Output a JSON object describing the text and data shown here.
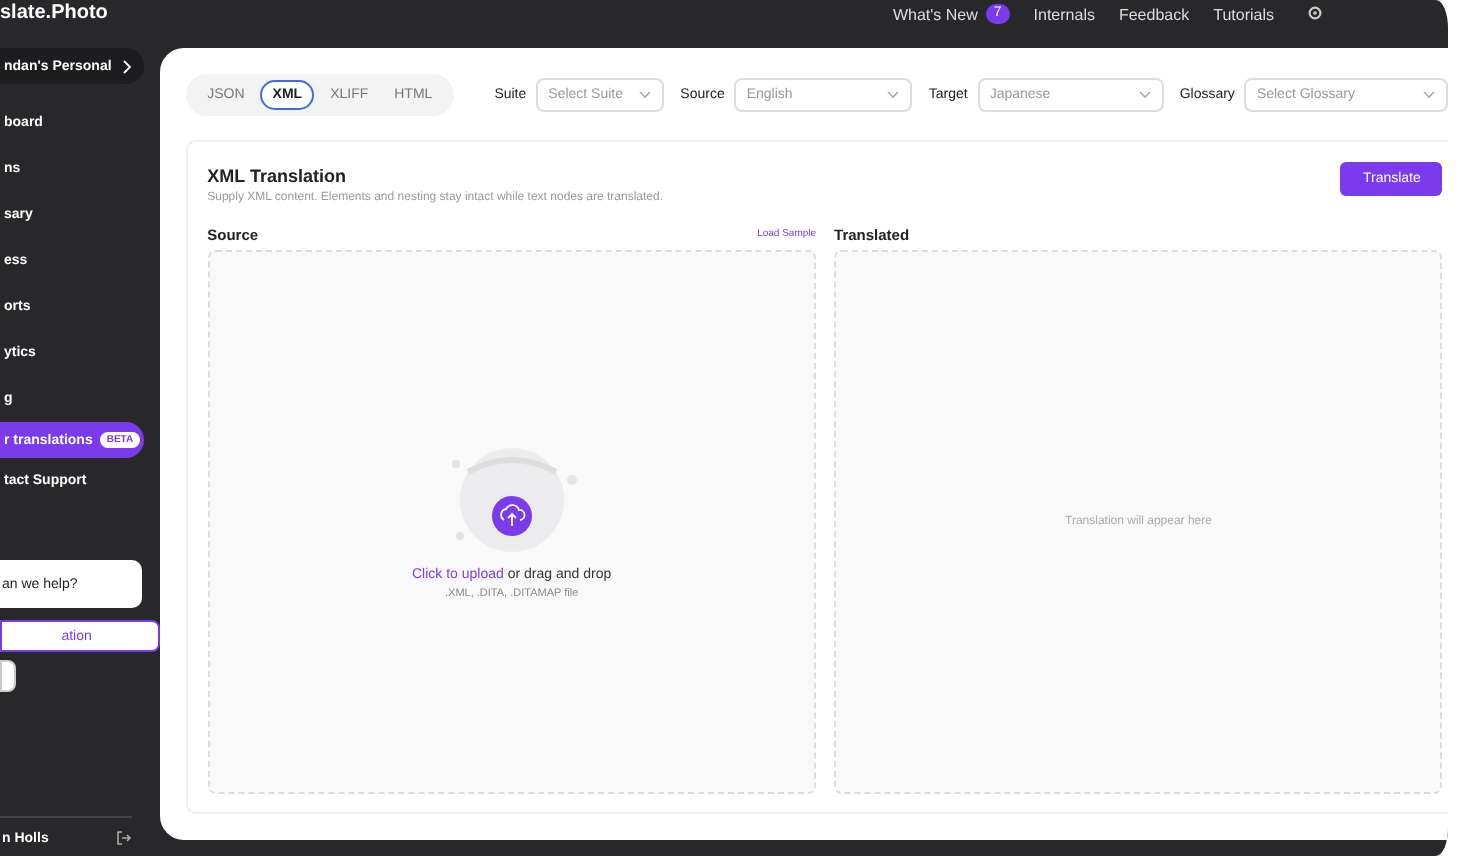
{
  "app": {
    "logo": "slate.Photo"
  },
  "top_nav": {
    "items": [
      {
        "label": "What's New",
        "badge": "7"
      },
      {
        "label": "Internals"
      },
      {
        "label": "Feedback"
      },
      {
        "label": "Tutorials"
      }
    ]
  },
  "sidebar": {
    "workspace": "ndan's Personal",
    "items": [
      {
        "label": "board",
        "selected": false
      },
      {
        "label": "ns",
        "selected": false
      },
      {
        "label": "sary",
        "selected": false
      },
      {
        "label": "ess",
        "selected": false
      },
      {
        "label": "orts",
        "selected": false
      },
      {
        "label": "ytics",
        "selected": false
      },
      {
        "label": "g",
        "selected": false
      },
      {
        "label": "r translations",
        "badge": "BETA",
        "selected": true
      },
      {
        "label": "tact Support",
        "selected": false
      }
    ],
    "help": {
      "title": "an we help?",
      "buttons": [
        "ation"
      ]
    },
    "user": {
      "name": "n Holls"
    }
  },
  "toolbar": {
    "formats": [
      {
        "label": "JSON",
        "selected": false
      },
      {
        "label": "XML",
        "selected": true
      },
      {
        "label": "XLIFF",
        "selected": false
      },
      {
        "label": "HTML",
        "selected": false
      }
    ],
    "selects": [
      {
        "label": "Suite",
        "placeholder": "Select Suite"
      },
      {
        "label": "Source",
        "value": "English"
      },
      {
        "label": "Target",
        "value": "Japanese"
      },
      {
        "label": "Glossary",
        "placeholder": "Select Glossary"
      }
    ]
  },
  "card": {
    "title": "XML Translation",
    "subtitle": "Supply XML content. Elements and nesting stay intact while text nodes are translated.",
    "action": "Translate",
    "source": {
      "label": "Source",
      "link": "Load Sample",
      "upload_link": "Click to upload",
      "upload_text": " or drag and drop",
      "formats": ".XML, .DITA, .DITAMAP file"
    },
    "translated": {
      "label": "Translated",
      "placeholder": "Translation will appear here"
    }
  }
}
